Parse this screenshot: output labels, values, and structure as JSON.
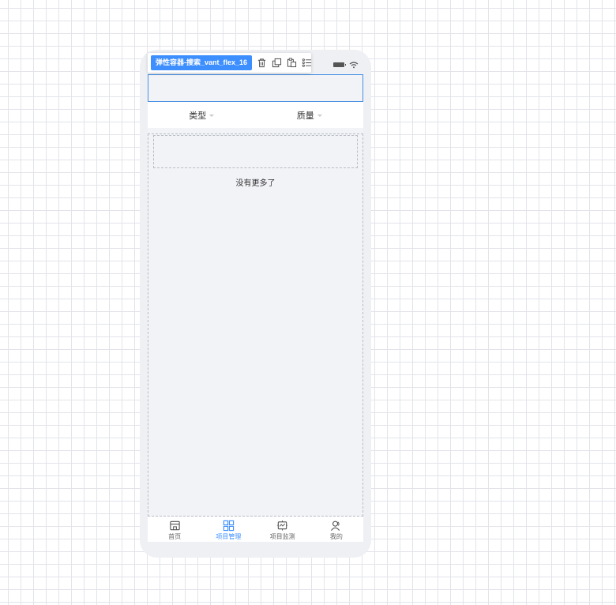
{
  "toolbar": {
    "component_label": "弹性容器-搜索_vant_flex_16",
    "icons": [
      "delete-icon",
      "copy-icon",
      "paste-icon",
      "list-settings-icon"
    ]
  },
  "filters": [
    {
      "label": "类型"
    },
    {
      "label": "质量"
    }
  ],
  "list": {
    "finished_text": "没有更多了"
  },
  "tabbar": {
    "items": [
      {
        "label": "首页",
        "icon": "store-icon",
        "active": false
      },
      {
        "label": "项目管理",
        "icon": "grid-icon",
        "active": true
      },
      {
        "label": "项目监测",
        "icon": "monitor-icon",
        "active": false
      },
      {
        "label": "我的",
        "icon": "user-icon",
        "active": false
      }
    ]
  },
  "colors": {
    "accent": "#3d8eff",
    "screen_bg": "#f2f3f7",
    "frame_bg": "#eef0f4",
    "selected_border": "#4a90e2"
  }
}
